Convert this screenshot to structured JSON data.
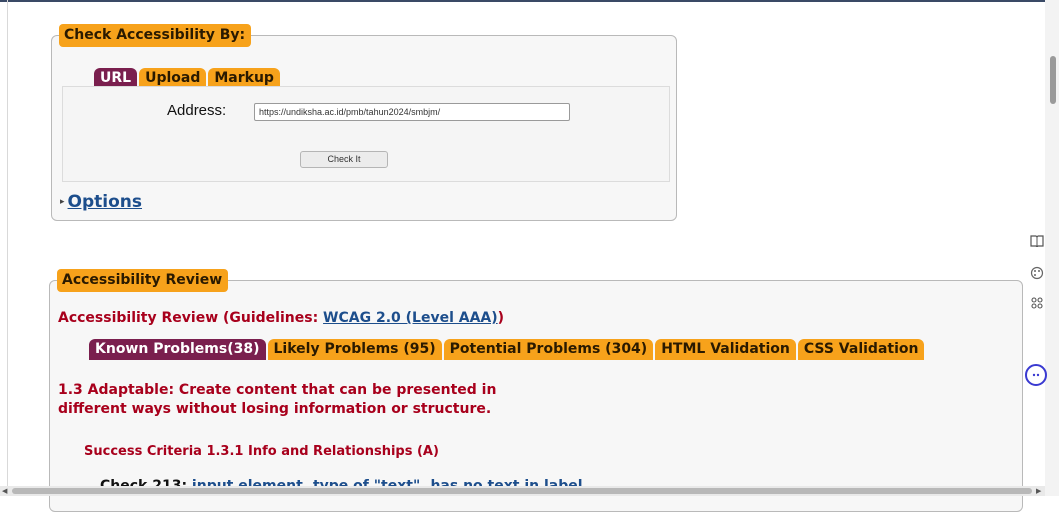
{
  "check_section": {
    "legend": "Check Accessibility By:",
    "tabs": [
      {
        "label": "URL",
        "active": true
      },
      {
        "label": "Upload",
        "active": false
      },
      {
        "label": "Markup",
        "active": false
      }
    ],
    "address_label": "Address:",
    "address_value": "https://undiksha.ac.id/pmb/tahun2024/smbjm/",
    "check_button": "Check It",
    "options_label": "Options"
  },
  "review_section": {
    "legend": "Accessibility Review",
    "title_prefix": "Accessibility Review (Guidelines: ",
    "guideline_link": "WCAG 2.0 (Level AAA)",
    "title_suffix": ")",
    "tabs": [
      {
        "label": "Known Problems(38)",
        "active": true
      },
      {
        "label": "Likely Problems (95)",
        "active": false
      },
      {
        "label": "Potential Problems (304)",
        "active": false
      },
      {
        "label": "HTML Validation",
        "active": false
      },
      {
        "label": "CSS Validation",
        "active": false
      }
    ],
    "heading": "1.3 Adaptable: Create content that can be presented in different ways without losing information or structure.",
    "success_criteria": "Success Criteria 1.3.1 Info and Relationships (A)",
    "check_line_prefix": "Check 213: ",
    "check_line_link": "input element, type of \"text\", has no text in label"
  },
  "sidebar_icons": [
    "book-icon",
    "palette-icon",
    "apps-icon",
    "assistant-icon"
  ],
  "colors": {
    "tab_orange": "#f7a21b",
    "tab_active": "#7a1f4e",
    "heading_red": "#a8001c",
    "link_blue": "#1d4e8c"
  }
}
